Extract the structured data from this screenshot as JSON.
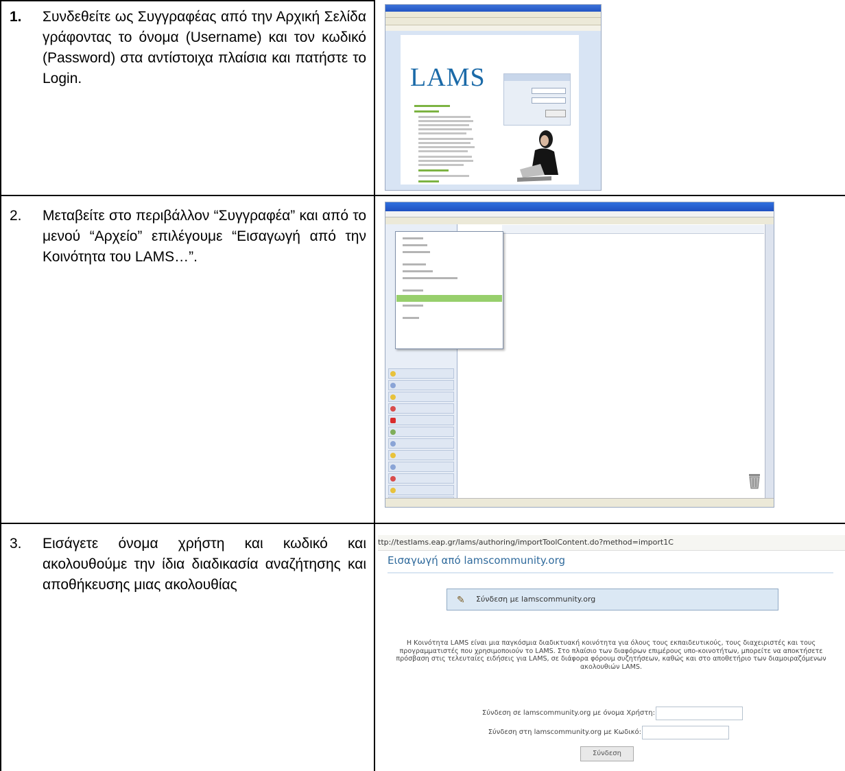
{
  "steps": [
    {
      "number": "1.",
      "text": "Συνδεθείτε ως Συγγραφέας από την Αρχική Σελίδα γράφοντας το όνομα (Username) και τον κωδικό (Password) στα αντίστοιχα πλαίσια και πατήστε το Login."
    },
    {
      "number": "2.",
      "text": "Μεταβείτε στο περιβάλλον “Συγγραφέα” και από το μενού “Αρχείο” επιλέγουμε “Εισαγωγή από την Κοινότητα του LAMS…”."
    },
    {
      "number": "3.",
      "text": "Εισάγετε όνομα χρήστη και κωδικό και ακολουθούμε την ίδια διαδικασία αναζήτησης και αποθήκευσης μιας ακολουθίας"
    }
  ],
  "screenshot1": {
    "logo": "LAMS"
  },
  "screenshot3": {
    "url": "ttp://testlams.eap.gr/lams/authoring/importToolContent.do?method=import1C",
    "heading": "Εισαγωγή από lamscommunity.org",
    "connect_label": "Σύνδεση με lamscommunity.org",
    "description": "Η Κοινότητα LAMS είναι μια παγκόσμια διαδικτυακή κοινότητα για όλους τους εκπαιδευτικούς, τους διαχειριστές και τους προγραμματιστές που χρησιμοποιούν το LAMS. Στο πλαίσιο των διαφόρων επιμέρους υπο-κοινοτήτων, μπορείτε να αποκτήσετε πρόσβαση στις τελευταίες ειδήσεις για LAMS, σε διάφορα φόρουμ συζητήσεων, καθώς και στο αποθετήριο των διαμοιραζόμενων ακολουθιών LAMS.",
    "username_label": "Σύνδεση σε lamscommunity.org με όνομα Χρήστη:",
    "password_label": "Σύνδεση στη lamscommunity.org με Κωδικό:",
    "button_label": "Σύνδεση"
  }
}
